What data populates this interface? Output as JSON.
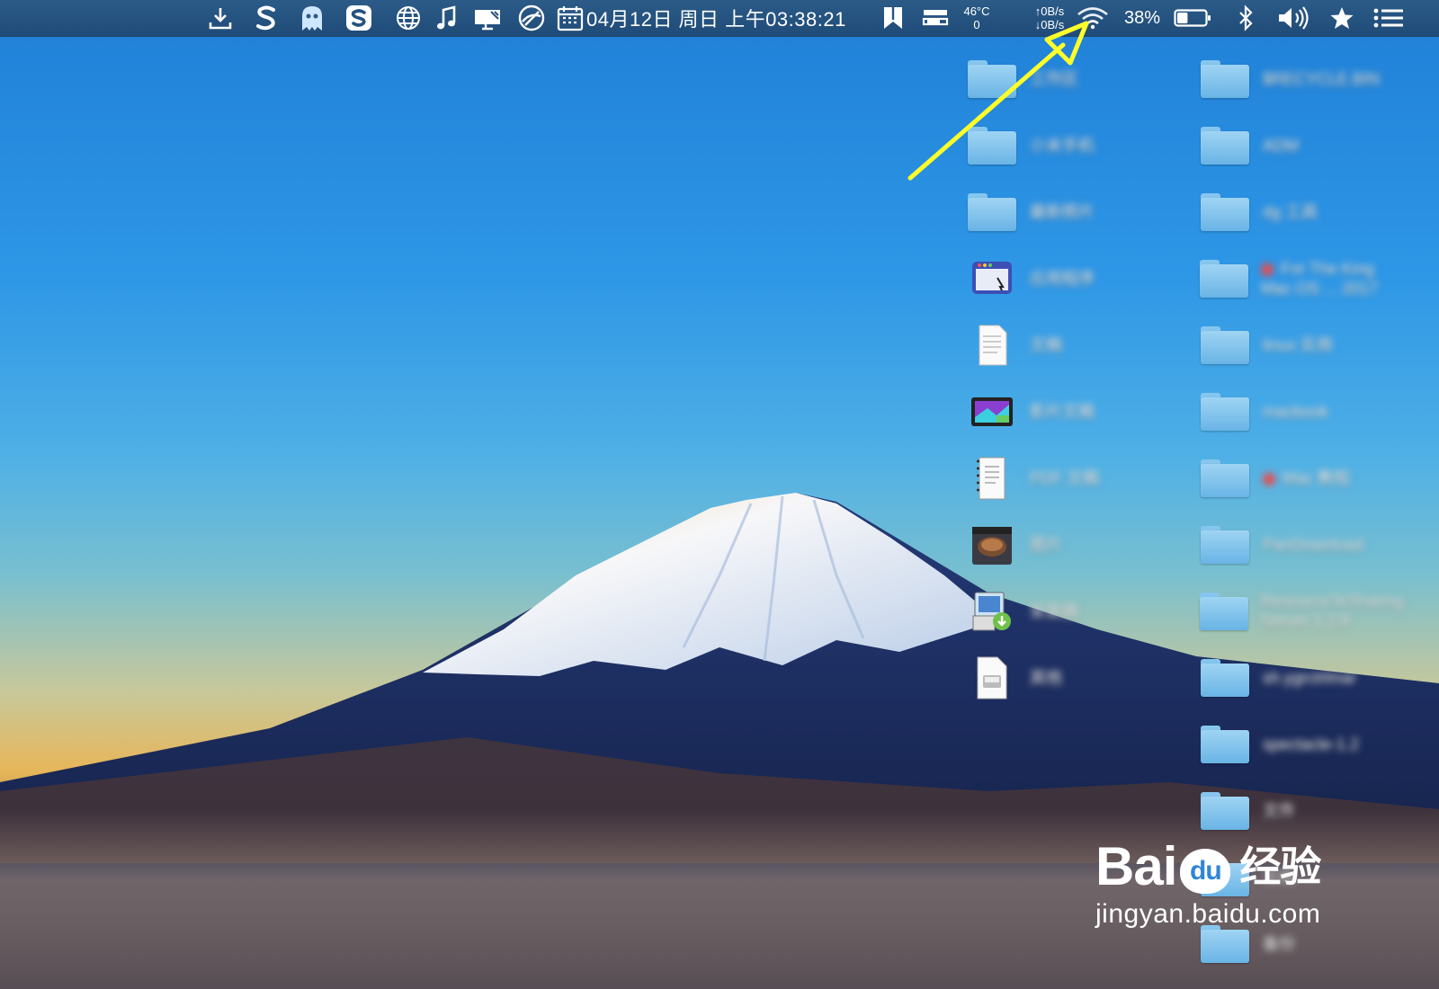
{
  "menubar": {
    "clock": "04月12日 周日 上午03:38:21",
    "temperature": {
      "value": "46°C",
      "fan": "0"
    },
    "network": {
      "up": "↑0B/s",
      "down": "↓0B/s"
    },
    "battery_percent": "38%",
    "battery_level": 0.38,
    "icons": [
      "download-icon",
      "s-app-icon",
      "ghost-icon",
      "sogou-input-icon",
      "globe-icon",
      "music-note-icon",
      "display-icon",
      "network-monitor-icon",
      "calendar-icon",
      "bookmark-icon",
      "display-arrange-icon",
      "wifi-icon",
      "battery-icon",
      "bluetooth-icon",
      "volume-icon",
      "star-icon",
      "list-icon"
    ]
  },
  "desktop": {
    "left_column": [
      {
        "name": "folder-1",
        "icon": "folder-icon",
        "label": "工作区"
      },
      {
        "name": "folder-2",
        "icon": "folder-icon",
        "label": "小米手机"
      },
      {
        "name": "folder-3",
        "icon": "folder-icon",
        "label": "最新照片"
      },
      {
        "name": "app-1",
        "icon": "application-icon",
        "label": "应用程序"
      },
      {
        "name": "doc-1",
        "icon": "document-icon",
        "label": "文稿"
      },
      {
        "name": "app-2",
        "icon": "media-app-icon",
        "label": "影片文稿"
      },
      {
        "name": "doc-2",
        "icon": "pdf-icon",
        "label": "PDF 文稿"
      },
      {
        "name": "app-3",
        "icon": "photo-app-icon",
        "label": "图片"
      },
      {
        "name": "app-4",
        "icon": "installer-icon",
        "label": "安装器"
      },
      {
        "name": "doc-3",
        "icon": "disk-image-icon",
        "label": "其他"
      }
    ],
    "right_column": [
      {
        "name": "folder-r1",
        "icon": "folder-icon",
        "label": "$RECYCLE.BIN"
      },
      {
        "name": "folder-r2",
        "icon": "folder-icon",
        "label": "ADM"
      },
      {
        "name": "folder-r3",
        "icon": "folder-icon",
        "label": "dg 工具"
      },
      {
        "name": "folder-r4",
        "icon": "folder-icon",
        "label": "For The King Mac OS ... 2017"
      },
      {
        "name": "folder-r5",
        "icon": "folder-icon",
        "label": "linux 实用"
      },
      {
        "name": "folder-r6",
        "icon": "folder-icon",
        "label": "macbook"
      },
      {
        "name": "folder-r7",
        "icon": "folder-icon",
        "label": "Mac 教程"
      },
      {
        "name": "folder-r8",
        "icon": "folder-icon",
        "label": "PanDownload"
      },
      {
        "name": "folder-r9",
        "icon": "folder-icon",
        "label": "ResourceTeSharing Server 1.2.8"
      },
      {
        "name": "folder-r10",
        "icon": "folder-icon",
        "label": "sh.ygrctrlmar"
      },
      {
        "name": "folder-r11",
        "icon": "folder-icon",
        "label": "spectacle-1.2"
      },
      {
        "name": "folder-r12",
        "icon": "folder-icon",
        "label": "文件"
      },
      {
        "name": "folder-r13",
        "icon": "folder-icon",
        "label": "文档"
      },
      {
        "name": "folder-r14",
        "icon": "folder-icon",
        "label": "备份"
      }
    ]
  },
  "watermark": {
    "brand_left": "Bai",
    "brand_du": "du",
    "brand_cn": "经验",
    "url": "jingyan.baidu.com"
  },
  "colors": {
    "menubar": "#24527f",
    "annotation_arrow": "#ffff2a",
    "folder": "#7cc0ec"
  }
}
